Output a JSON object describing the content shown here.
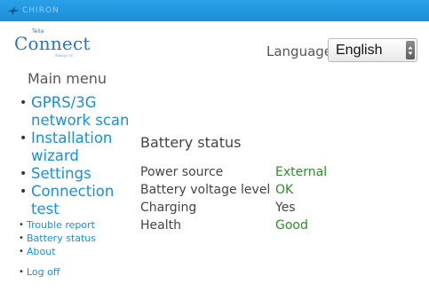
{
  "header": {
    "brand": "CHIRON",
    "logo_small": "Telia",
    "logo_main": "Connect",
    "logo_tagline": "Always on"
  },
  "language": {
    "label": "Language:",
    "selected": "English"
  },
  "menu": {
    "title": "Main menu",
    "primary_items": [
      "GPRS/3G network scan",
      "Installation wizard",
      "Settings",
      "Connection test"
    ],
    "secondary_items": [
      "Trouble report",
      "Battery status",
      "About"
    ],
    "logoff": "Log off"
  },
  "battery": {
    "title": "Battery status",
    "rows": [
      {
        "label": "Power source",
        "value": "External"
      },
      {
        "label": "Battery voltage level",
        "value": "OK"
      },
      {
        "label": "Charging",
        "value": "Yes"
      },
      {
        "label": "Health",
        "value": "Good"
      }
    ]
  },
  "colors": {
    "topbar": "#1a8fd6",
    "link": "#1a8fd6",
    "ok_green": "#2e8b28"
  }
}
